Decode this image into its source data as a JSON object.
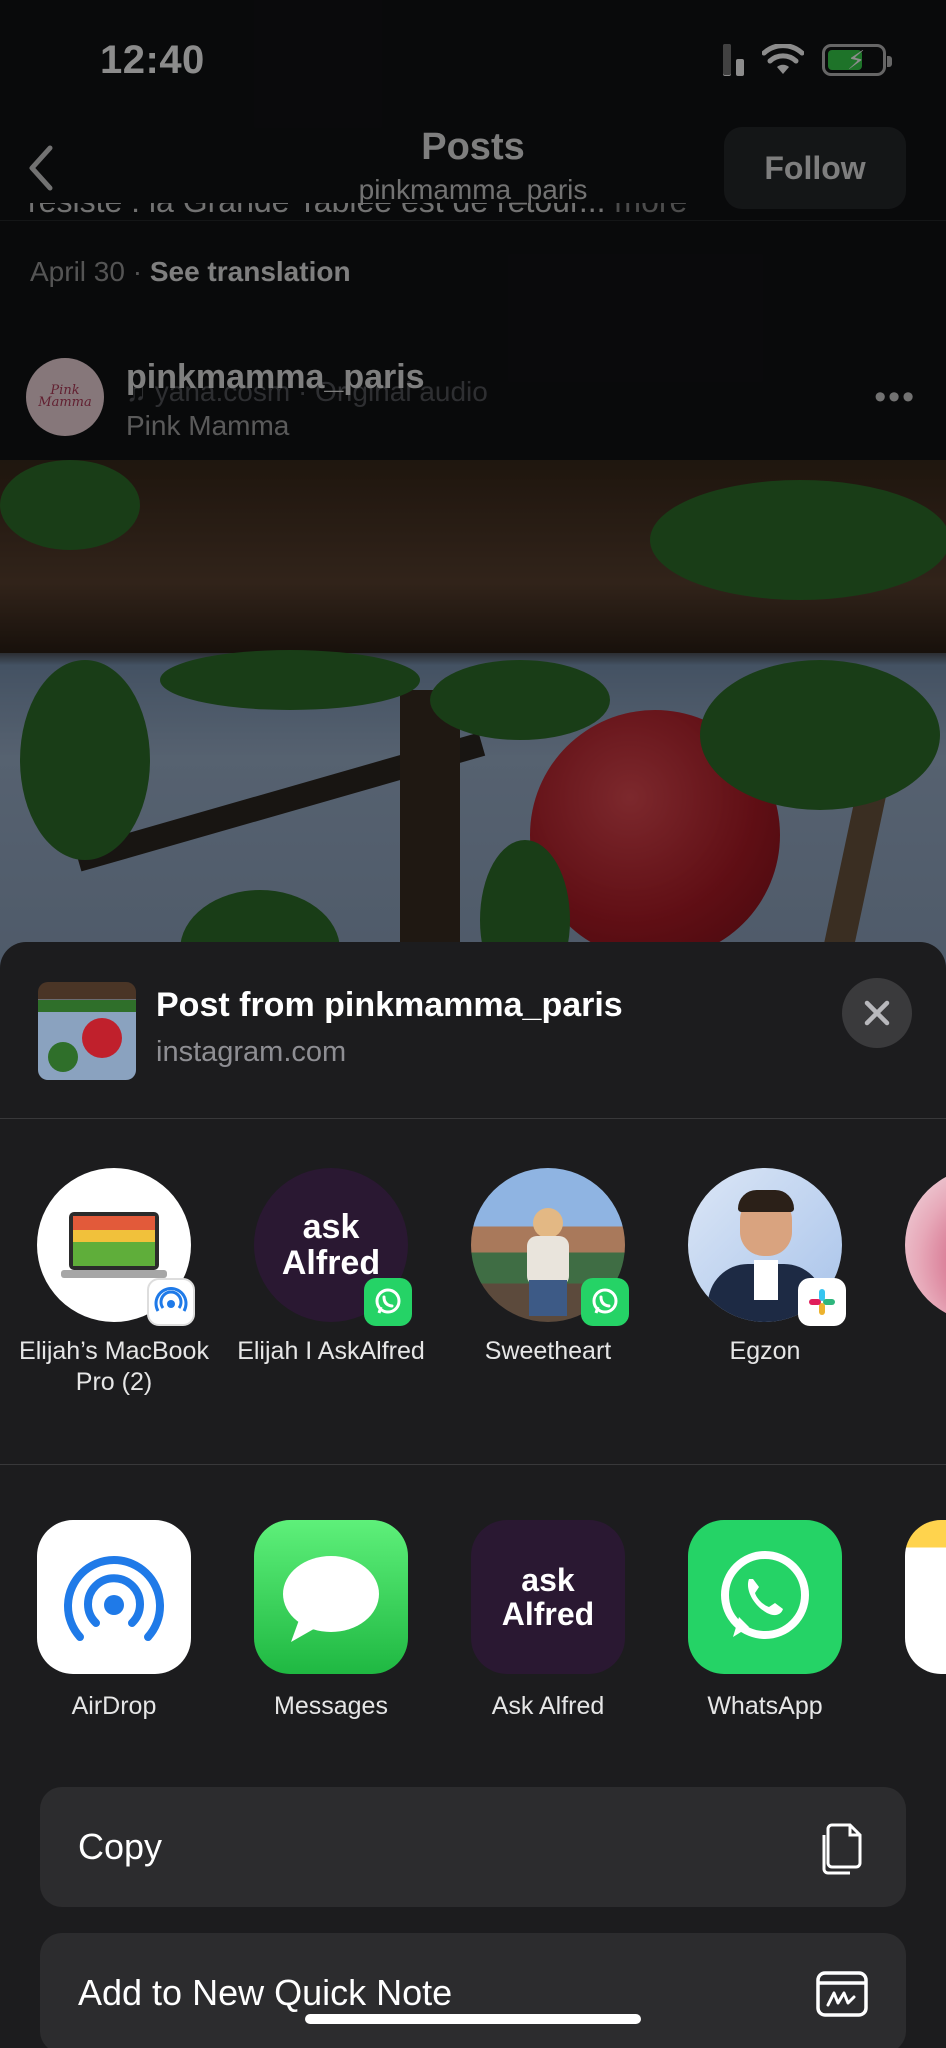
{
  "status_bar": {
    "time": "12:40"
  },
  "nav": {
    "title": "Posts",
    "subtitle": "pinkmamma_paris",
    "follow_label": "Follow"
  },
  "post": {
    "caption_cut": "résiste : la Grande Tablée est de retour...",
    "caption_more": "more",
    "date": "April 30",
    "see_translation": "See translation",
    "author": "pinkmamma_paris",
    "audio": "♫ yana.cosm · Original audio",
    "location": "Pink Mamma",
    "avatar_text": "Pink Mamma"
  },
  "share": {
    "title": "Post from pinkmamma_paris",
    "subtitle": "instagram.com",
    "people": [
      {
        "name": "Elijah’s MacBook Pro (2)",
        "badge": "airdrop-badge"
      },
      {
        "name": "Elijah I AskAlfred",
        "badge": "whatsapp-badge",
        "avatar_text": "ask Alfred"
      },
      {
        "name": "Sweetheart",
        "badge": "whatsapp-badge"
      },
      {
        "name": "Egzon",
        "badge": "slack-badge"
      }
    ],
    "apps": [
      {
        "name": "AirDrop"
      },
      {
        "name": "Messages"
      },
      {
        "name": "Ask Alfred",
        "icon_text": "ask Alfred"
      },
      {
        "name": "WhatsApp"
      }
    ],
    "actions": [
      {
        "label": "Copy",
        "icon": "copy-icon"
      },
      {
        "label": "Add to New Quick Note",
        "icon": "quick-note-icon"
      }
    ]
  },
  "colors": {
    "whatsapp": "#25d366",
    "messages": "#34c759",
    "airdrop": "#1f7ae8",
    "alfred_bg": "#2a1832",
    "sheet": "#1c1c1e"
  }
}
